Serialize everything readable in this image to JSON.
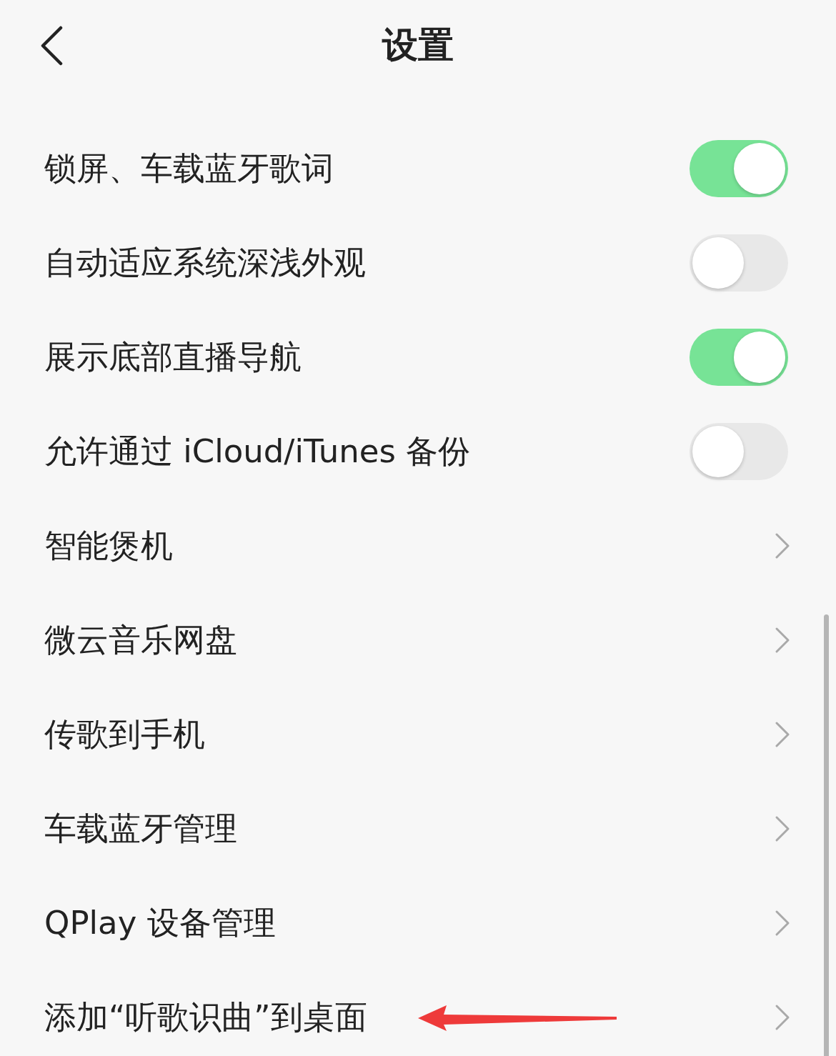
{
  "header": {
    "title": "设置"
  },
  "items": [
    {
      "kind": "toggle",
      "label": "锁屏、车载蓝牙歌词",
      "on": true
    },
    {
      "kind": "toggle",
      "label": "自动适应系统深浅外观",
      "on": false
    },
    {
      "kind": "toggle",
      "label": "展示底部直播导航",
      "on": true
    },
    {
      "kind": "toggle",
      "label": "允许通过 iCloud/iTunes 备份",
      "on": false
    },
    {
      "kind": "link",
      "label": "智能煲机"
    },
    {
      "kind": "link",
      "label": "微云音乐网盘"
    },
    {
      "kind": "link",
      "label": "传歌到手机"
    },
    {
      "kind": "link",
      "label": "车载蓝牙管理"
    },
    {
      "kind": "link",
      "label": "QPlay 设备管理"
    },
    {
      "kind": "link",
      "label": "添加“听歌识曲”到桌面"
    }
  ]
}
